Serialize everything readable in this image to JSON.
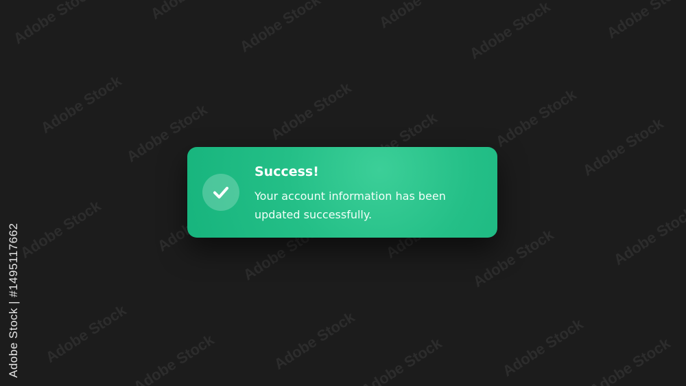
{
  "background_color": "#1c1c1c",
  "accent_color": "#24bf87",
  "watermark": {
    "text": "Adobe Stock"
  },
  "stock_id": "Adobe Stock | #1495117662",
  "toast": {
    "icon": "check-icon",
    "title": "Success!",
    "message": "Your account information has been updated successfully."
  }
}
